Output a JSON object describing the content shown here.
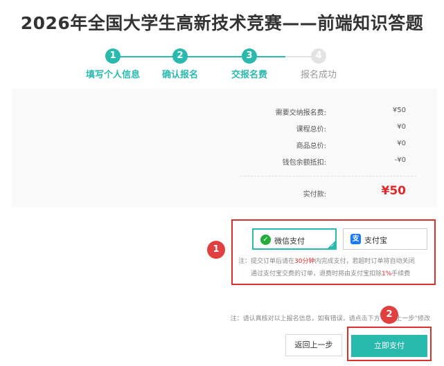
{
  "page": {
    "title": "2026年全国大学生高新技术竞赛——前端知识答题"
  },
  "stepper": {
    "steps": [
      {
        "num": "1",
        "label": "填写个人信息"
      },
      {
        "num": "2",
        "label": "确认报名"
      },
      {
        "num": "3",
        "label": "交报名费"
      },
      {
        "num": "4",
        "label": "报名成功"
      }
    ]
  },
  "summary": {
    "rows": [
      {
        "label": "需要交纳报名费:",
        "value": "¥50"
      },
      {
        "label": "课程总价:",
        "value": "¥0"
      },
      {
        "label": "商品总价:",
        "value": "¥0"
      },
      {
        "label": "钱包余额抵扣:",
        "value": "-¥0"
      }
    ],
    "total_label": "实付款:",
    "total_value": "¥50"
  },
  "payment": {
    "wechat_label": "微信支付",
    "alipay_label": "支付宝",
    "selected": "wechat",
    "note_prefix": "注：提交订单后请在",
    "note_highlight_time": "30分钟",
    "note_mid": "内完成支付，若超时订单将自动关闭",
    "note_line2_prefix": "通过支付宝交费的订单，退费时将由支付宝扣除",
    "note_highlight_pct": "1%",
    "note_line2_suffix": "手续费"
  },
  "annotations": {
    "badge_1": "1",
    "badge_2": "2"
  },
  "bottom_note": "注：请认真核对以上报名信息，如有错误，请点击下方“返回上一步”修改",
  "buttons": {
    "back_label": "返回上一步",
    "pay_label": "立即支付"
  },
  "colors": {
    "accent": "#2ab9ad",
    "price": "#e02828",
    "annotation": "#d9302b"
  },
  "icons": {
    "wechat": "wechat-icon",
    "alipay": "alipay-icon",
    "check": "check-icon"
  }
}
